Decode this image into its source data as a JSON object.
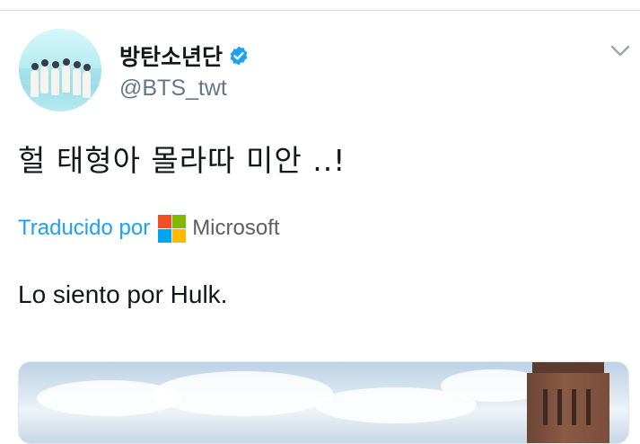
{
  "tweet": {
    "display_name": "방탄소년단",
    "handle": "@BTS_twt",
    "text": "헐 태형아 몰라따 미안 ..!",
    "translation": {
      "label": "Traducido por",
      "provider": "Microsoft",
      "text": "Lo siento por Hulk."
    }
  },
  "icons": {
    "verified": "verified-badge-icon",
    "menu": "chevron-down-icon",
    "provider_logo": "microsoft-logo-icon"
  },
  "colors": {
    "link_blue": "#1da1f2",
    "verified_blue": "#1da1f2",
    "text_primary": "#14171a",
    "text_secondary": "#657786"
  }
}
